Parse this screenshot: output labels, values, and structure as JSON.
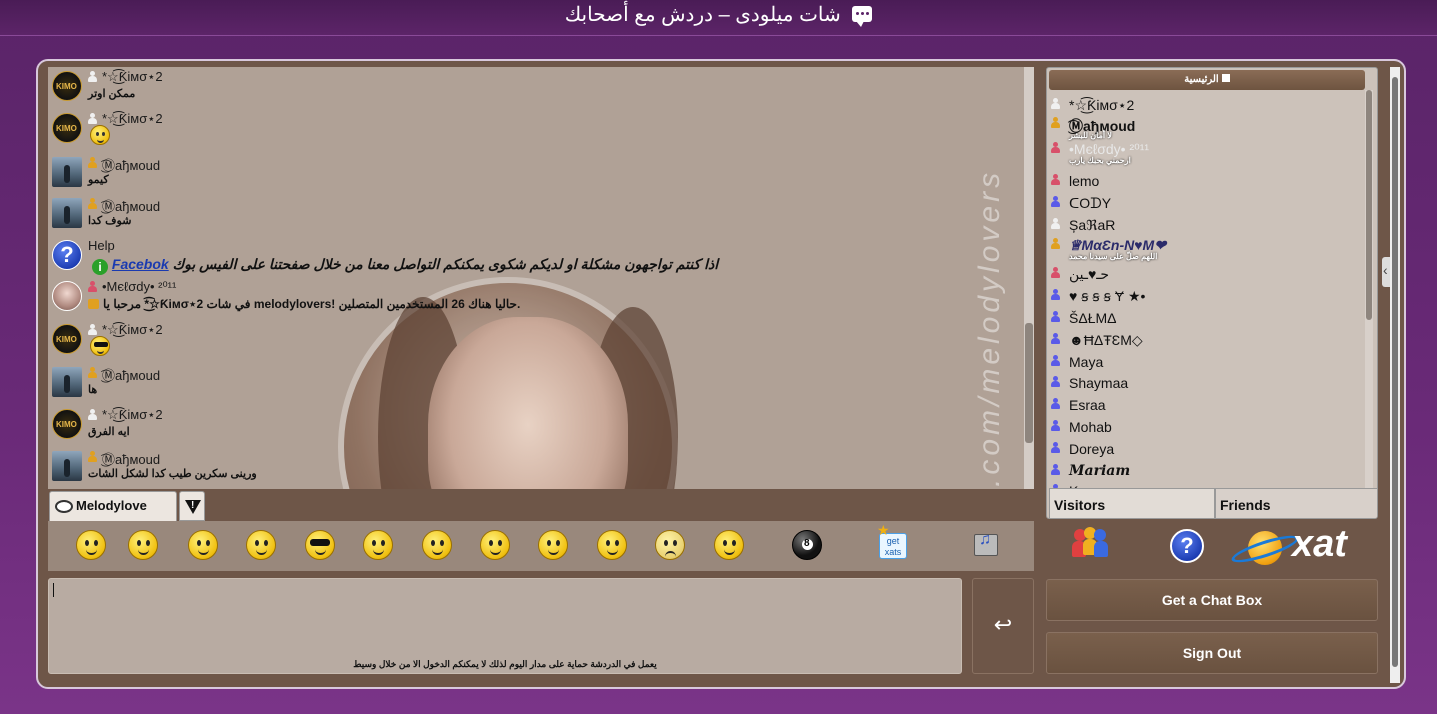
{
  "header": {
    "title": "شات ميلودى – دردش مع أصحابك",
    "icon": "chat-bubble-icon"
  },
  "messages": [
    {
      "avatar": "kimo",
      "avatar_label": "KIMO",
      "rank": "white",
      "user": "*☆͜͡Ƙімσ⋆2",
      "text": "ممكن اوتر"
    },
    {
      "avatar": "kimo",
      "avatar_label": "KIMO",
      "rank": "white",
      "user": "*☆͜͡Ƙімσ⋆2",
      "smiley": "smile"
    },
    {
      "avatar": "mahmoud",
      "rank": "gold",
      "user": "͜͡Ⓜaђмoud",
      "text": "كيمو"
    },
    {
      "avatar": "mahmoud",
      "rank": "gold",
      "user": "͜͡Ⓜaђмoud",
      "text": "شوف كدا"
    },
    {
      "avatar": "help",
      "avatar_label": "?",
      "user": "Help",
      "help_text": "اذا كنتم تواجهون مشكلة او لديكم شكوى يمكنكم التواصل معنا من خلال صفحتنا على الفيس بوك",
      "help_link": "Facebok"
    },
    {
      "avatar": "melody",
      "rank": "red",
      "user": "•Mєℓσdу• ²⁰¹¹",
      "welcome_text": "مرحبا يا *☆͜͡Ƙімσ⋆2 في شات melodylovers! حاليا هناك 26 المستخدمين المتصلين."
    },
    {
      "avatar": "kimo",
      "avatar_label": "KIMO",
      "rank": "white",
      "user": "*☆͜͡Ƙімσ⋆2",
      "smiley": "cool"
    },
    {
      "avatar": "mahmoud",
      "rank": "gold",
      "user": "͜͡Ⓜaђмoud",
      "text": "ها"
    },
    {
      "avatar": "kimo",
      "avatar_label": "KIMO",
      "rank": "white",
      "user": "*☆͜͡Ƙімσ⋆2",
      "text": "ايه الفرق"
    },
    {
      "avatar": "mahmoud",
      "rank": "gold",
      "user": "͜͡Ⓜaђмoud",
      "text": "ورينى سكرين طيب كدا لشكل الشات"
    }
  ],
  "watermark": ".com/melodylovers",
  "chat_tab": {
    "label": "Melodylove"
  },
  "input": {
    "value": "",
    "notice": "يعمل في الدردشة حماية على مدار اليوم لذلك لا يمكنكم الدخول الا من خلال وسيط"
  },
  "send_button": {
    "icon": "↩"
  },
  "emojis": [
    "clap",
    "grin",
    "surprised",
    "blush",
    "cool",
    "roll-eyes",
    "yawn",
    "facepalm",
    "think",
    "wide-eyed",
    "sad",
    "crazy",
    "8-ball",
    "get-xats",
    "media"
  ],
  "get_xats": "get xats",
  "users_panel": {
    "heading": "الرئيسية",
    "users": [
      {
        "name": "*☆͜͡Ƙімσ⋆2",
        "rank": "white"
      },
      {
        "name": "͜͡Ⓜaђмoud",
        "rank": "gold",
        "status": "لا أمان للبشر"
      },
      {
        "name": "•Mєℓσdу• ²⁰¹¹",
        "rank": "red",
        "status": "ارحمني بحبك يارب"
      },
      {
        "name": "lemo",
        "rank": "red"
      },
      {
        "name": "ᑕOᗪY",
        "rank": "blue"
      },
      {
        "name": "ȘaℜaR",
        "rank": "white"
      },
      {
        "name": "♕MαƐn-N♥M❤",
        "rank": "gold",
        "status": "اللهم صلّ على سيدنا محمد"
      },
      {
        "name": "حـ♥ـين",
        "rank": "blue"
      },
      {
        "name": "♥ ꞩ ꞩ ꞩ Ɏ ★•",
        "rank": "blue"
      },
      {
        "name": "ŠΔŁMΔ",
        "rank": "blue"
      },
      {
        "name": "☻ĦΔŦƐΜ◇",
        "rank": "blue"
      },
      {
        "name": "Maya",
        "rank": "blue"
      },
      {
        "name": "Shaymaa",
        "rank": "blue"
      },
      {
        "name": "Esraa",
        "rank": "blue"
      },
      {
        "name": "Mohab",
        "rank": "blue"
      },
      {
        "name": "Doreya",
        "rank": "blue"
      },
      {
        "name": "𝑴𝒂𝒓𝒊𝒂𝒎",
        "rank": "blue"
      },
      {
        "name": "K",
        "rank": "blue"
      }
    ],
    "tabs": {
      "visitors": "Visitors",
      "friends": "Friends"
    }
  },
  "apps": {
    "xat_logo": "xat"
  },
  "buttons": {
    "get_chat_box": "Get a Chat Box",
    "sign_out": "Sign Out"
  },
  "colors": {
    "frame": "#6e5648",
    "page": "#5a2468",
    "rank_white": "#f0f0f0",
    "rank_gold": "#e0a020",
    "rank_red": "#d8506a",
    "rank_blue": "#5a5ae8",
    "link": "#1a3ab0"
  }
}
